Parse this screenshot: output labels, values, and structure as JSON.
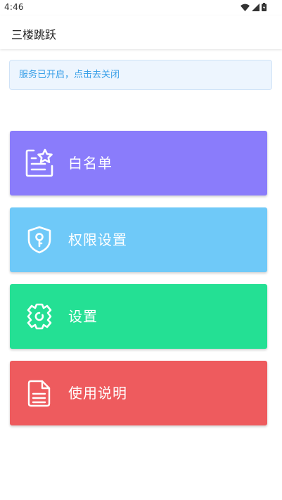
{
  "status_bar": {
    "time": "4:46"
  },
  "app_bar": {
    "title": "三楼跳跃"
  },
  "banner": {
    "text": "服务已开启，点击去关闭",
    "color": "#3aa0e8",
    "background": "#edf5fe"
  },
  "menu": [
    {
      "label": "白名单",
      "icon": "list-star-icon",
      "color": "#8a7cfb"
    },
    {
      "label": "权限设置",
      "icon": "shield-key-icon",
      "color": "#6fc9f8"
    },
    {
      "label": "设置",
      "icon": "gear-icon",
      "color": "#24e094"
    },
    {
      "label": "使用说明",
      "icon": "document-icon",
      "color": "#ee5b5e"
    }
  ]
}
